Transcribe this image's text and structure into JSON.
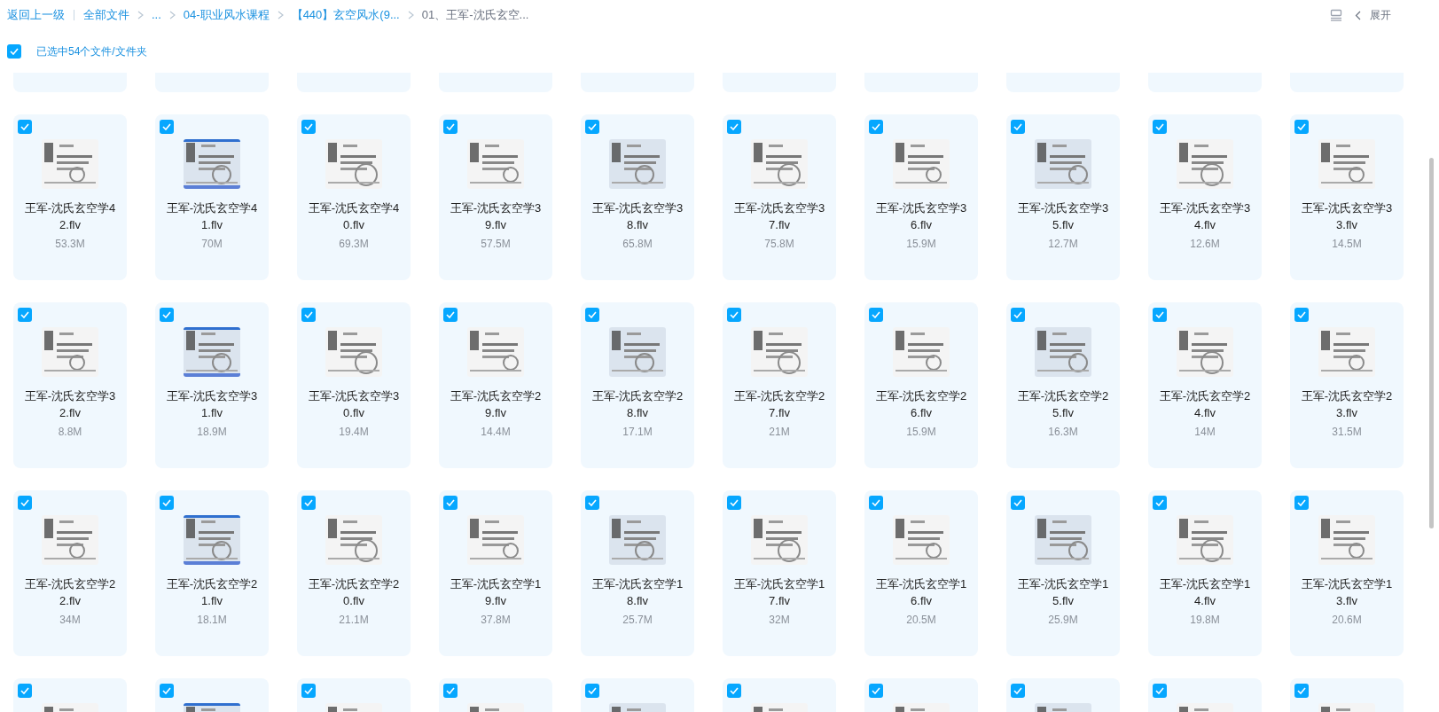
{
  "breadcrumb": {
    "back": "返回上一级",
    "items": [
      {
        "label": "全部文件",
        "current": false
      },
      {
        "label": "...",
        "current": false
      },
      {
        "label": "04-职业风水课程",
        "current": false
      },
      {
        "label": "【440】玄空风水(9...",
        "current": false
      },
      {
        "label": "01、王军-沈氏玄空...",
        "current": true
      }
    ]
  },
  "toolbar": {
    "expand_label": "展开"
  },
  "selection": {
    "checked": true,
    "label": "已选中54个文件/文件夹"
  },
  "cards": [
    {
      "kind": "cut_top"
    },
    {
      "kind": "cut_top"
    },
    {
      "kind": "cut_top"
    },
    {
      "kind": "cut_top"
    },
    {
      "kind": "cut_top"
    },
    {
      "kind": "cut_top"
    },
    {
      "kind": "cut_top"
    },
    {
      "kind": "cut_top"
    },
    {
      "kind": "cut_top"
    },
    {
      "kind": "cut_top"
    },
    {
      "kind": "full",
      "selected": true,
      "name": "王军-沈氏玄空学42.flv",
      "size": "53.3M"
    },
    {
      "kind": "full",
      "selected": true,
      "name": "王军-沈氏玄空学41.flv",
      "size": "70M"
    },
    {
      "kind": "full",
      "selected": true,
      "name": "王军-沈氏玄空学40.flv",
      "size": "69.3M"
    },
    {
      "kind": "full",
      "selected": true,
      "name": "王军-沈氏玄空学39.flv",
      "size": "57.5M"
    },
    {
      "kind": "full",
      "selected": true,
      "name": "王军-沈氏玄空学38.flv",
      "size": "65.8M"
    },
    {
      "kind": "full",
      "selected": true,
      "name": "王军-沈氏玄空学37.flv",
      "size": "75.8M"
    },
    {
      "kind": "full",
      "selected": true,
      "name": "王军-沈氏玄空学36.flv",
      "size": "15.9M"
    },
    {
      "kind": "full",
      "selected": true,
      "name": "王军-沈氏玄空学35.flv",
      "size": "12.7M"
    },
    {
      "kind": "full",
      "selected": true,
      "name": "王军-沈氏玄空学34.flv",
      "size": "12.6M"
    },
    {
      "kind": "full",
      "selected": true,
      "name": "王军-沈氏玄空学33.flv",
      "size": "14.5M"
    },
    {
      "kind": "full",
      "selected": true,
      "name": "王军-沈氏玄空学32.flv",
      "size": "8.8M"
    },
    {
      "kind": "full",
      "selected": true,
      "name": "王军-沈氏玄空学31.flv",
      "size": "18.9M"
    },
    {
      "kind": "full",
      "selected": true,
      "name": "王军-沈氏玄空学30.flv",
      "size": "19.4M"
    },
    {
      "kind": "full",
      "selected": true,
      "name": "王军-沈氏玄空学29.flv",
      "size": "14.4M"
    },
    {
      "kind": "full",
      "selected": true,
      "name": "王军-沈氏玄空学28.flv",
      "size": "17.1M"
    },
    {
      "kind": "full",
      "selected": true,
      "name": "王军-沈氏玄空学27.flv",
      "size": "21M"
    },
    {
      "kind": "full",
      "selected": true,
      "name": "王军-沈氏玄空学26.flv",
      "size": "15.9M"
    },
    {
      "kind": "full",
      "selected": true,
      "name": "王军-沈氏玄空学25.flv",
      "size": "16.3M"
    },
    {
      "kind": "full",
      "selected": true,
      "name": "王军-沈氏玄空学24.flv",
      "size": "14M"
    },
    {
      "kind": "full",
      "selected": true,
      "name": "王军-沈氏玄空学23.flv",
      "size": "31.5M"
    },
    {
      "kind": "full",
      "selected": true,
      "name": "王军-沈氏玄空学22.flv",
      "size": "34M"
    },
    {
      "kind": "full",
      "selected": true,
      "name": "王军-沈氏玄空学21.flv",
      "size": "18.1M"
    },
    {
      "kind": "full",
      "selected": true,
      "name": "王军-沈氏玄空学20.flv",
      "size": "21.1M"
    },
    {
      "kind": "full",
      "selected": true,
      "name": "王军-沈氏玄空学19.flv",
      "size": "37.8M"
    },
    {
      "kind": "full",
      "selected": true,
      "name": "王军-沈氏玄空学18.flv",
      "size": "25.7M"
    },
    {
      "kind": "full",
      "selected": true,
      "name": "王军-沈氏玄空学17.flv",
      "size": "32M"
    },
    {
      "kind": "full",
      "selected": true,
      "name": "王军-沈氏玄空学16.flv",
      "size": "20.5M"
    },
    {
      "kind": "full",
      "selected": true,
      "name": "王军-沈氏玄空学15.flv",
      "size": "25.9M"
    },
    {
      "kind": "full",
      "selected": true,
      "name": "王军-沈氏玄空学14.flv",
      "size": "19.8M"
    },
    {
      "kind": "full",
      "selected": true,
      "name": "王军-沈氏玄空学13.flv",
      "size": "20.6M"
    },
    {
      "kind": "cut_bottom",
      "selected": true
    },
    {
      "kind": "cut_bottom",
      "selected": true
    },
    {
      "kind": "cut_bottom",
      "selected": true
    },
    {
      "kind": "cut_bottom",
      "selected": true
    },
    {
      "kind": "cut_bottom",
      "selected": true
    },
    {
      "kind": "cut_bottom",
      "selected": true
    },
    {
      "kind": "cut_bottom",
      "selected": true
    },
    {
      "kind": "cut_bottom",
      "selected": true
    },
    {
      "kind": "cut_bottom",
      "selected": true
    },
    {
      "kind": "cut_bottom",
      "selected": true
    }
  ]
}
